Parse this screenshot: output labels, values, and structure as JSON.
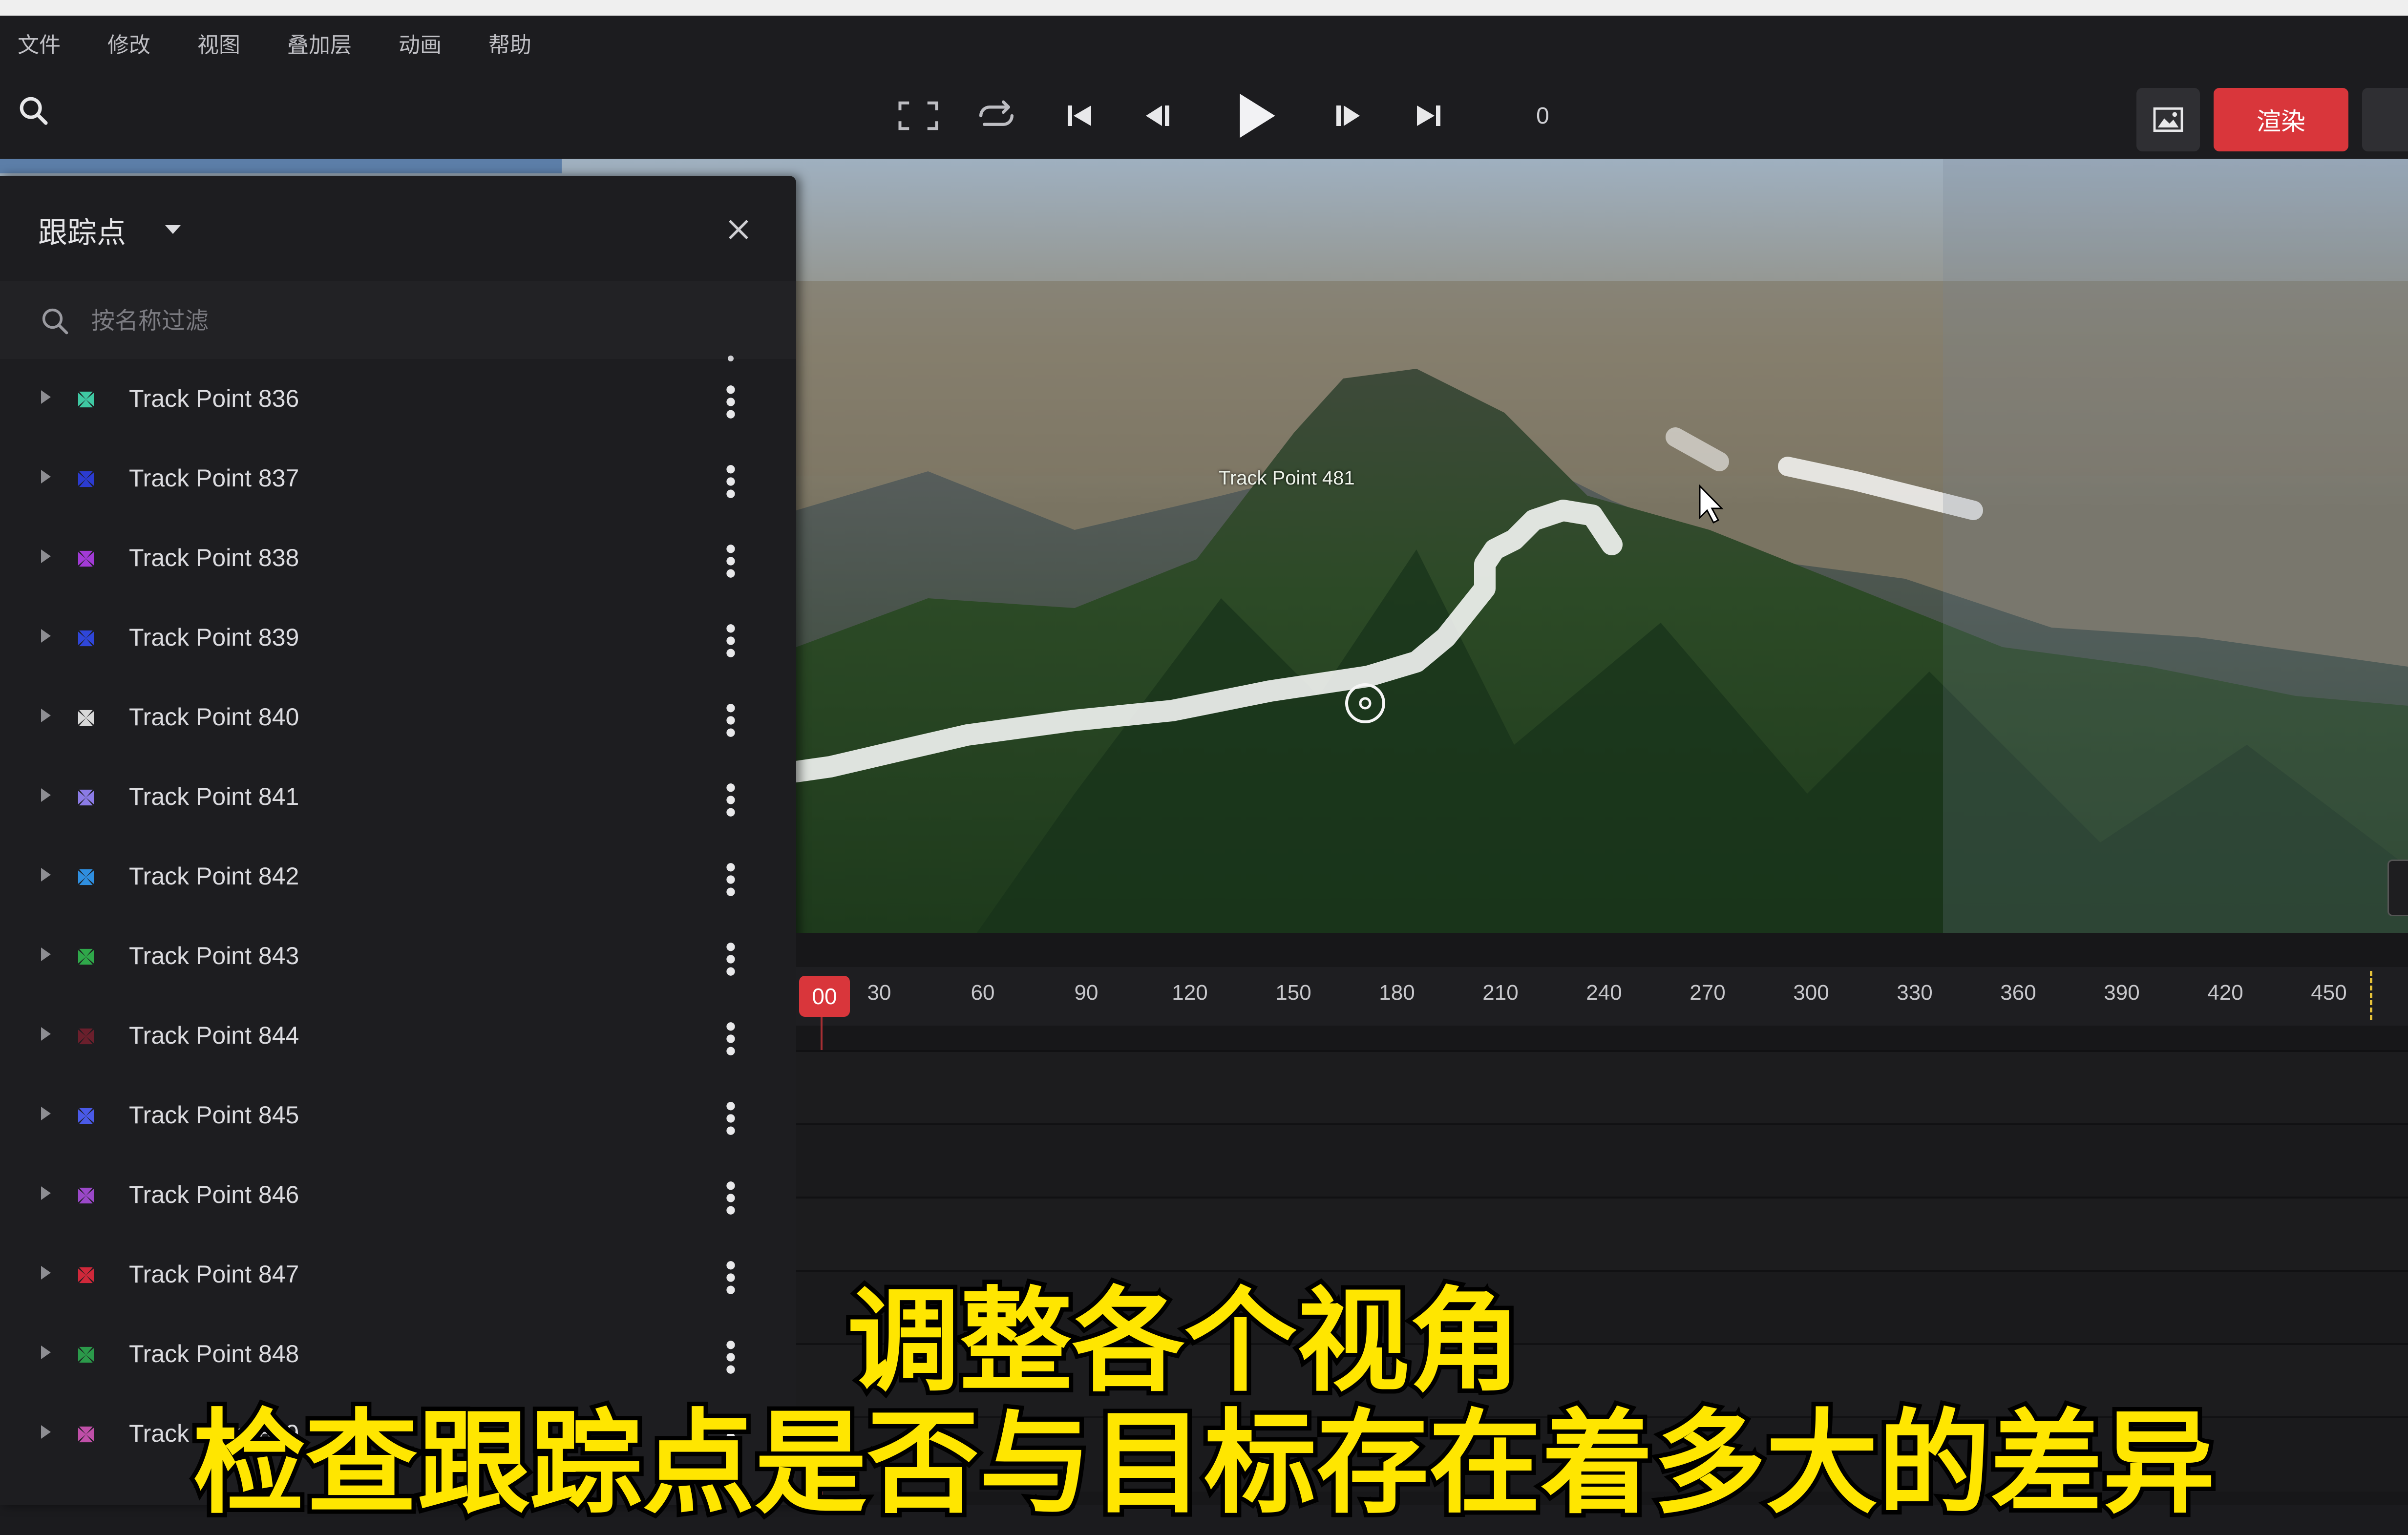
{
  "menu": [
    "文件",
    "修改",
    "视图",
    "叠加层",
    "动画",
    "帮助"
  ],
  "toolbar": {
    "frame": "0",
    "render_label": "渲染"
  },
  "viewport": {
    "track_label": "Track Point 481"
  },
  "panel": {
    "title": "跟踪点",
    "filter_placeholder": "按名称过滤",
    "items": [
      {
        "label": "Track Point 836",
        "color": "#3fc9a3"
      },
      {
        "label": "Track Point 837",
        "color": "#2b3bd1"
      },
      {
        "label": "Track Point 838",
        "color": "#a23ad6"
      },
      {
        "label": "Track Point 839",
        "color": "#2f46d9"
      },
      {
        "label": "Track Point 840",
        "color": "#d8d8d8"
      },
      {
        "label": "Track Point 841",
        "color": "#8b7be6"
      },
      {
        "label": "Track Point 842",
        "color": "#2f8fe0"
      },
      {
        "label": "Track Point 843",
        "color": "#2fa84a"
      },
      {
        "label": "Track Point 844",
        "color": "#6b1f2c"
      },
      {
        "label": "Track Point 845",
        "color": "#4a5ae8"
      },
      {
        "label": "Track Point 846",
        "color": "#9b48c9"
      },
      {
        "label": "Track Point 847",
        "color": "#d0283a"
      },
      {
        "label": "Track Point 848",
        "color": "#2b9a4a"
      },
      {
        "label": "Track Point 849",
        "color": "#c04fa8"
      }
    ]
  },
  "timeline": {
    "current_frame": "00",
    "ticks": [
      "30",
      "60",
      "90",
      "120",
      "150",
      "180",
      "210",
      "240",
      "270",
      "300",
      "330",
      "360",
      "390",
      "420",
      "450"
    ]
  },
  "subtitles": {
    "line1": "调整各个视角",
    "line2": "检查跟踪点是否与目标存在着多大的差异"
  },
  "colors": {
    "accent": "#d9363b",
    "subtitle": "#ffe600"
  }
}
